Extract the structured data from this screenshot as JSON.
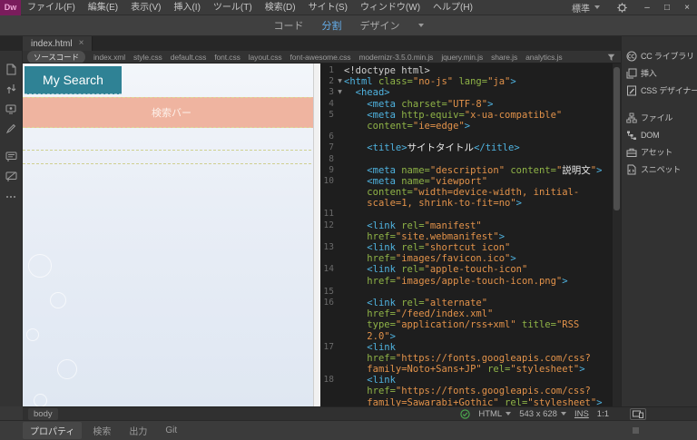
{
  "window": {
    "app": "Dw",
    "workspace": "標準",
    "controls": {
      "minimize": "–",
      "maximize": "□",
      "close": "×"
    }
  },
  "menu": {
    "items": [
      "ファイル(F)",
      "編集(E)",
      "表示(V)",
      "挿入(I)",
      "ツール(T)",
      "検索(D)",
      "サイト(S)",
      "ウィンドウ(W)",
      "ヘルプ(H)"
    ]
  },
  "view_switcher": {
    "code": "コード",
    "split": "分割",
    "design": "デザイン",
    "active": "分割"
  },
  "document_tab": {
    "title": "index.html",
    "close": "×"
  },
  "related_files": [
    "ソースコード",
    "index.xml",
    "style.css",
    "default.css",
    "font.css",
    "layout.css",
    "font-awesome.css",
    "modernizr-3.5.0.min.js",
    "jquery.min.js",
    "share.js",
    "analytics.js"
  ],
  "design_view": {
    "site_title": "My Search",
    "search_bar_label": "検索バー"
  },
  "code_view": {
    "rows": [
      {
        "n": "1",
        "f": 0,
        "s": [
          [
            "p",
            "<!doctype html>"
          ]
        ]
      },
      {
        "n": "2",
        "f": 1,
        "s": [
          [
            "t",
            "<html "
          ],
          [
            "a",
            "class="
          ],
          [
            "v",
            "\"no-js\""
          ],
          [
            "p",
            " "
          ],
          [
            "a",
            "lang="
          ],
          [
            "v",
            "\"ja\""
          ],
          [
            "t",
            ">"
          ]
        ]
      },
      {
        "n": "3",
        "f": 1,
        "s": [
          [
            "p",
            "  "
          ],
          [
            "t",
            "<head>"
          ]
        ]
      },
      {
        "n": "4",
        "f": 0,
        "s": [
          [
            "p",
            "    "
          ],
          [
            "t",
            "<meta "
          ],
          [
            "a",
            "charset="
          ],
          [
            "v",
            "\"UTF-8\""
          ],
          [
            "t",
            ">"
          ]
        ]
      },
      {
        "n": "5",
        "f": 0,
        "s": [
          [
            "p",
            "    "
          ],
          [
            "t",
            "<meta "
          ],
          [
            "a",
            "http-equiv="
          ],
          [
            "v",
            "\"x-ua-compatible\""
          ]
        ]
      },
      {
        "n": "",
        "f": 0,
        "s": [
          [
            "p",
            "    "
          ],
          [
            "a",
            "content="
          ],
          [
            "v",
            "\"ie=edge\""
          ],
          [
            "t",
            ">"
          ]
        ]
      },
      {
        "n": "6",
        "f": 0,
        "s": []
      },
      {
        "n": "7",
        "f": 0,
        "s": [
          [
            "p",
            "    "
          ],
          [
            "t",
            "<title>"
          ],
          [
            "j",
            "サイトタイトル"
          ],
          [
            "t",
            "</title>"
          ]
        ]
      },
      {
        "n": "8",
        "f": 0,
        "s": []
      },
      {
        "n": "9",
        "f": 0,
        "s": [
          [
            "p",
            "    "
          ],
          [
            "t",
            "<meta "
          ],
          [
            "a",
            "name="
          ],
          [
            "v",
            "\"description\""
          ],
          [
            "p",
            " "
          ],
          [
            "a",
            "content="
          ],
          [
            "v",
            "\""
          ],
          [
            "j",
            "説明文"
          ],
          [
            "v",
            "\""
          ],
          [
            "t",
            ">"
          ]
        ]
      },
      {
        "n": "10",
        "f": 0,
        "s": [
          [
            "p",
            "    "
          ],
          [
            "t",
            "<meta "
          ],
          [
            "a",
            "name="
          ],
          [
            "v",
            "\"viewport\""
          ]
        ]
      },
      {
        "n": "",
        "f": 0,
        "s": [
          [
            "p",
            "    "
          ],
          [
            "a",
            "content="
          ],
          [
            "v",
            "\"width=device-width, initial-"
          ]
        ]
      },
      {
        "n": "",
        "f": 0,
        "s": [
          [
            "p",
            "    "
          ],
          [
            "v",
            "scale=1, shrink-to-fit=no\""
          ],
          [
            "t",
            ">"
          ]
        ]
      },
      {
        "n": "11",
        "f": 0,
        "s": []
      },
      {
        "n": "12",
        "f": 0,
        "s": [
          [
            "p",
            "    "
          ],
          [
            "t",
            "<link "
          ],
          [
            "a",
            "rel="
          ],
          [
            "v",
            "\"manifest\""
          ]
        ]
      },
      {
        "n": "",
        "f": 0,
        "s": [
          [
            "p",
            "    "
          ],
          [
            "a",
            "href="
          ],
          [
            "v",
            "\"site.webmanifest\""
          ],
          [
            "t",
            ">"
          ]
        ]
      },
      {
        "n": "13",
        "f": 0,
        "s": [
          [
            "p",
            "    "
          ],
          [
            "t",
            "<link "
          ],
          [
            "a",
            "rel="
          ],
          [
            "v",
            "\"shortcut icon\""
          ]
        ]
      },
      {
        "n": "",
        "f": 0,
        "s": [
          [
            "p",
            "    "
          ],
          [
            "a",
            "href="
          ],
          [
            "v",
            "\"images/favicon.ico\""
          ],
          [
            "t",
            ">"
          ]
        ]
      },
      {
        "n": "14",
        "f": 0,
        "s": [
          [
            "p",
            "    "
          ],
          [
            "t",
            "<link "
          ],
          [
            "a",
            "rel="
          ],
          [
            "v",
            "\"apple-touch-icon\""
          ]
        ]
      },
      {
        "n": "",
        "f": 0,
        "s": [
          [
            "p",
            "    "
          ],
          [
            "a",
            "href="
          ],
          [
            "v",
            "\"images/apple-touch-icon.png\""
          ],
          [
            "t",
            ">"
          ]
        ]
      },
      {
        "n": "15",
        "f": 0,
        "s": []
      },
      {
        "n": "16",
        "f": 0,
        "s": [
          [
            "p",
            "    "
          ],
          [
            "t",
            "<link "
          ],
          [
            "a",
            "rel="
          ],
          [
            "v",
            "\"alternate\""
          ]
        ]
      },
      {
        "n": "",
        "f": 0,
        "s": [
          [
            "p",
            "    "
          ],
          [
            "a",
            "href="
          ],
          [
            "v",
            "\"/feed/index.xml\""
          ]
        ]
      },
      {
        "n": "",
        "f": 0,
        "s": [
          [
            "p",
            "    "
          ],
          [
            "a",
            "type="
          ],
          [
            "v",
            "\"application/rss+xml\""
          ],
          [
            "p",
            " "
          ],
          [
            "a",
            "title="
          ],
          [
            "v",
            "\"RSS"
          ]
        ]
      },
      {
        "n": "",
        "f": 0,
        "s": [
          [
            "p",
            "    "
          ],
          [
            "v",
            "2.0\""
          ],
          [
            "t",
            ">"
          ]
        ]
      },
      {
        "n": "17",
        "f": 0,
        "s": [
          [
            "p",
            "    "
          ],
          [
            "t",
            "<link"
          ]
        ]
      },
      {
        "n": "",
        "f": 0,
        "s": [
          [
            "p",
            "    "
          ],
          [
            "a",
            "href="
          ],
          [
            "v",
            "\"https://fonts.googleapis.com/css?"
          ]
        ]
      },
      {
        "n": "",
        "f": 0,
        "s": [
          [
            "p",
            "    "
          ],
          [
            "v",
            "family=Noto+Sans+JP\""
          ],
          [
            "p",
            " "
          ],
          [
            "a",
            "rel="
          ],
          [
            "v",
            "\"stylesheet\""
          ],
          [
            "t",
            ">"
          ]
        ]
      },
      {
        "n": "18",
        "f": 0,
        "s": [
          [
            "p",
            "    "
          ],
          [
            "t",
            "<link"
          ]
        ]
      },
      {
        "n": "",
        "f": 0,
        "s": [
          [
            "p",
            "    "
          ],
          [
            "a",
            "href="
          ],
          [
            "v",
            "\"https://fonts.googleapis.com/css?"
          ]
        ]
      },
      {
        "n": "",
        "f": 0,
        "s": [
          [
            "p",
            "    "
          ],
          [
            "v",
            "family=Sawarabi+Gothic\""
          ],
          [
            "p",
            " "
          ],
          [
            "a",
            "rel="
          ],
          [
            "v",
            "\"stylesheet\""
          ],
          [
            "t",
            ">"
          ]
        ]
      }
    ]
  },
  "sidebar": {
    "panels": [
      {
        "label": "CC ライブラリ"
      },
      {
        "label": "挿入"
      },
      {
        "label": "CSS デザイナー"
      },
      {
        "label": "ファイル"
      },
      {
        "label": "DOM"
      },
      {
        "label": "アセット"
      },
      {
        "label": "スニペット"
      }
    ]
  },
  "status_bar": {
    "tag": "body",
    "doc_type": "HTML",
    "dimensions": "543 x 628",
    "insert_mode": "INS",
    "zoom": "1:1"
  },
  "bottom_tabs": [
    "プロパティ",
    "検索",
    "出力",
    "Git"
  ],
  "icons": {
    "code_fold": "▼"
  },
  "colors": {
    "title_teal": "#2f8295",
    "search_salmon": "#efb4a0",
    "syntax_tag": "#4fb3e0",
    "syntax_attr": "#8fb347",
    "syntax_value": "#e2924a",
    "active_view_blue": "#64ace8",
    "lint_ok_green": "#4caf50",
    "logo_purple": "#7a1c5c"
  }
}
